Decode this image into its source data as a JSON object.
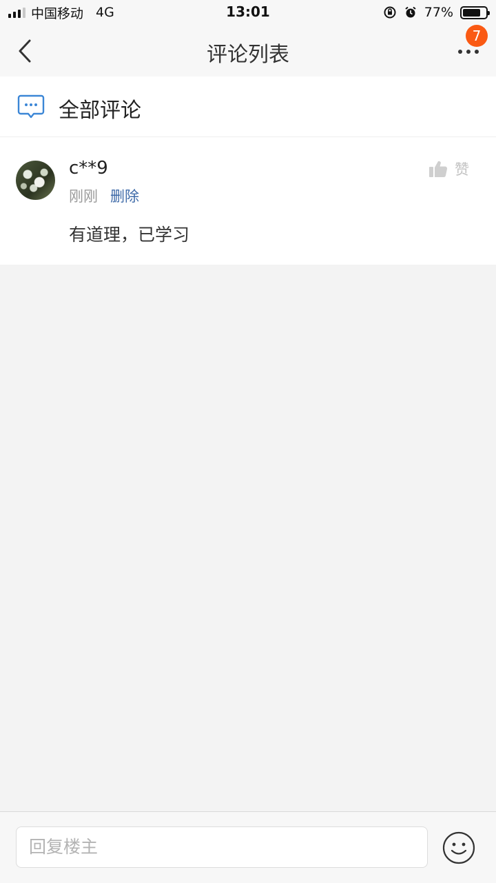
{
  "status_bar": {
    "carrier": "中国移动",
    "network": "4G",
    "time": "13:01",
    "battery_percent": "77%",
    "battery_level": 0.77,
    "icons": [
      "signal-icon",
      "orientation-lock-icon",
      "alarm-icon",
      "battery-icon"
    ]
  },
  "nav": {
    "title": "评论列表",
    "back_icon": "chevron-left-icon",
    "more_icon": "more-dots-icon",
    "badge_count": "7",
    "badge_color": "#fa5a14"
  },
  "section": {
    "icon": "comment-bubble-icon",
    "title": "全部评论",
    "icon_color": "#3b86d6"
  },
  "comments": [
    {
      "avatar": "avatar-image",
      "username": "c**9",
      "time": "刚刚",
      "delete_label": "删除",
      "like_label": "赞",
      "like_icon": "thumbs-up-icon",
      "text": "有道理，已学习"
    }
  ],
  "composer": {
    "placeholder": "回复楼主",
    "emoji_icon": "smiley-icon"
  },
  "colors": {
    "link": "#3e6aa8",
    "muted": "#999999",
    "page_bg": "#f3f3f3"
  }
}
